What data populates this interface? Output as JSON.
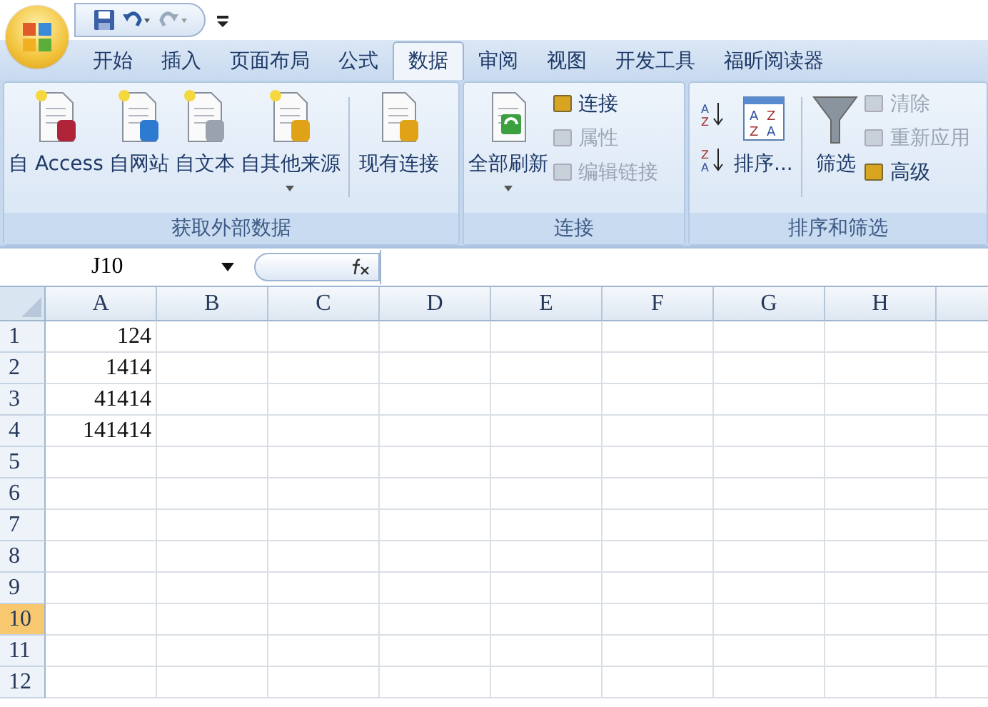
{
  "tabs": [
    {
      "label": "开始",
      "selected": false
    },
    {
      "label": "插入",
      "selected": false
    },
    {
      "label": "页面布局",
      "selected": false
    },
    {
      "label": "公式",
      "selected": false
    },
    {
      "label": "数据",
      "selected": true
    },
    {
      "label": "审阅",
      "selected": false
    },
    {
      "label": "视图",
      "selected": false
    },
    {
      "label": "开发工具",
      "selected": false
    },
    {
      "label": "福昕阅读器",
      "selected": false
    }
  ],
  "ribbon_groups": [
    {
      "label": "获取外部数据",
      "items": [
        {
          "kind": "large",
          "label": "自 Access",
          "dropdown": false
        },
        {
          "kind": "large",
          "label": "自网站",
          "dropdown": false
        },
        {
          "kind": "large",
          "label": "自文本",
          "dropdown": false
        },
        {
          "kind": "large",
          "label": "自其他来源",
          "dropdown": true
        },
        {
          "kind": "separator"
        },
        {
          "kind": "large",
          "label": "现有连接",
          "dropdown": false
        }
      ]
    },
    {
      "label": "连接",
      "items": [
        {
          "kind": "large",
          "label": "全部刷新",
          "dropdown": true
        },
        {
          "kind": "stack",
          "items": [
            {
              "label": "连接",
              "disabled": false
            },
            {
              "label": "属性",
              "disabled": true
            },
            {
              "label": "编辑链接",
              "disabled": true
            }
          ]
        }
      ]
    },
    {
      "label": "排序和筛选",
      "items": [
        {
          "kind": "sort_icons",
          "letters": [
            [
              "A",
              "Z"
            ],
            [
              "Z",
              "A"
            ]
          ]
        },
        {
          "kind": "large",
          "label": "排序...",
          "dropdown": false,
          "icon_letters": [
            "A",
            "Z",
            "Z",
            "A"
          ]
        },
        {
          "kind": "separator"
        },
        {
          "kind": "large",
          "label": "筛选",
          "dropdown": false
        },
        {
          "kind": "stack",
          "items": [
            {
              "label": "清除",
              "disabled": true
            },
            {
              "label": "重新应用",
              "disabled": true
            },
            {
              "label": "高级",
              "disabled": false
            }
          ]
        }
      ]
    }
  ],
  "name_box": "J10",
  "columns": [
    "A",
    "B",
    "C",
    "D",
    "E",
    "F",
    "G",
    "H"
  ],
  "rows": [
    {
      "header": "1",
      "selected": false,
      "value": "124"
    },
    {
      "header": "2",
      "selected": false,
      "value": "1414"
    },
    {
      "header": "3",
      "selected": false,
      "value": "41414"
    },
    {
      "header": "4",
      "selected": false,
      "value": "141414"
    },
    {
      "header": "5",
      "selected": false
    },
    {
      "header": "6",
      "selected": false
    },
    {
      "header": "7",
      "selected": false
    },
    {
      "header": "8",
      "selected": false
    },
    {
      "header": "9",
      "selected": false
    },
    {
      "header": "10",
      "selected": true
    },
    {
      "header": "11",
      "selected": false
    },
    {
      "header": "12",
      "selected": false
    }
  ]
}
